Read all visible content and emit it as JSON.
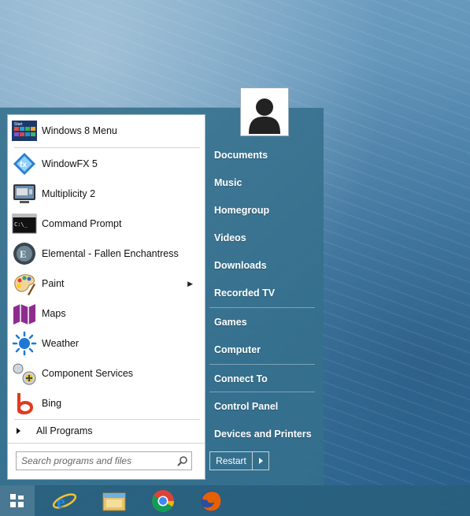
{
  "menu": {
    "programs": [
      {
        "label": "Windows 8 Menu",
        "icon": "windows8-menu-icon"
      },
      {
        "label": "WindowFX 5",
        "icon": "windowfx-icon"
      },
      {
        "label": "Multiplicity 2",
        "icon": "multiplicity-icon"
      },
      {
        "label": "Command Prompt",
        "icon": "command-prompt-icon"
      },
      {
        "label": "Elemental - Fallen Enchantress",
        "icon": "elemental-icon"
      },
      {
        "label": "Paint",
        "icon": "paint-icon"
      },
      {
        "label": "Maps",
        "icon": "maps-icon"
      },
      {
        "label": "Weather",
        "icon": "weather-icon"
      },
      {
        "label": "Component Services",
        "icon": "component-services-icon"
      },
      {
        "label": "Bing",
        "icon": "bing-icon"
      }
    ],
    "all_programs": "All Programs",
    "search_placeholder": "Search programs and files",
    "cmd_text": "C:\\_",
    "tile_text": "Start"
  },
  "places": [
    "Documents",
    "Music",
    "Homegroup",
    "Videos",
    "Downloads",
    "Recorded TV",
    "Games",
    "Computer",
    "Connect To",
    "Control Panel",
    "Devices and Printers"
  ],
  "power": {
    "restart_label": "Restart"
  },
  "taskbar": {
    "apps": [
      "internet-explorer-icon",
      "file-explorer-icon",
      "chrome-icon",
      "firefox-icon"
    ]
  },
  "colors": {
    "accent": "#3a7896",
    "panel_bg": "#ffffff"
  }
}
